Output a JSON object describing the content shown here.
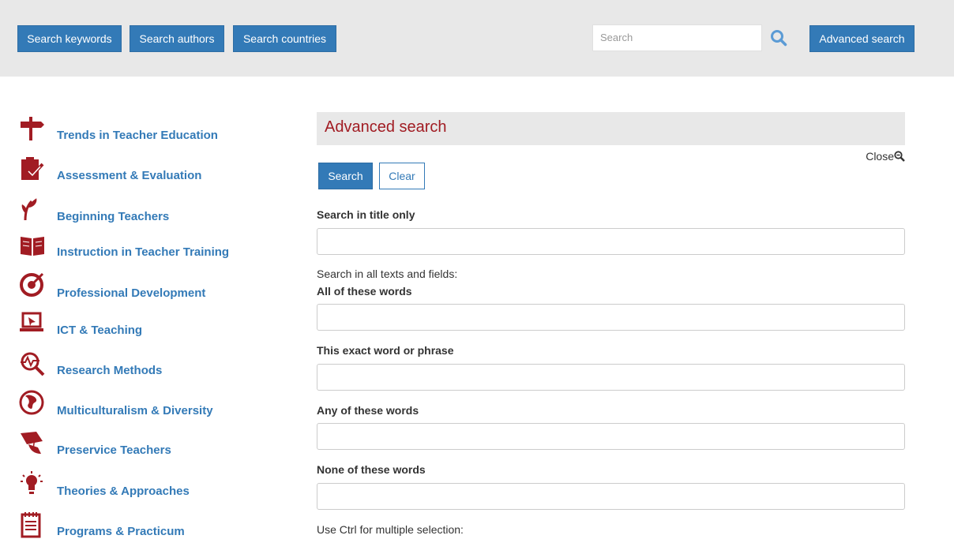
{
  "topbar": {
    "search_keywords": "Search keywords",
    "search_authors": "Search authors",
    "search_countries": "Search countries",
    "search_placeholder": "Search",
    "advanced_search": "Advanced search"
  },
  "sidebar": {
    "items": [
      {
        "label": "Trends in Teacher Education",
        "icon": "signpost-icon"
      },
      {
        "label": "Assessment & Evaluation",
        "icon": "clipboard-check-icon"
      },
      {
        "label": "Beginning Teachers",
        "icon": "sprout-icon"
      },
      {
        "label": "Instruction in Teacher Training",
        "icon": "open-book-icon"
      },
      {
        "label": "Professional Development",
        "icon": "target-icon"
      },
      {
        "label": "ICT & Teaching",
        "icon": "laptop-icon"
      },
      {
        "label": "Research Methods",
        "icon": "magnifier-chart-icon"
      },
      {
        "label": "Multiculturalism & Diversity",
        "icon": "globe-icon"
      },
      {
        "label": "Preservice Teachers",
        "icon": "graduation-cap-icon"
      },
      {
        "label": "Theories & Approaches",
        "icon": "lightbulb-icon"
      },
      {
        "label": "Programs & Practicum",
        "icon": "notepad-icon"
      }
    ]
  },
  "advanced": {
    "title": "Advanced search",
    "close": "Close",
    "search_button": "Search",
    "clear_button": "Clear",
    "title_only_label": "Search in title only",
    "all_texts_note": "Search in all texts and fields:",
    "all_words_label": "All of these words",
    "exact_phrase_label": "This exact word or phrase",
    "any_words_label": "Any of these words",
    "none_words_label": "None of these words",
    "ctrl_note": "Use Ctrl for multiple selection:"
  },
  "colors": {
    "accent_blue": "#337ab7",
    "brand_red": "#a11c23",
    "topbar_gray": "#e8e8e8"
  }
}
